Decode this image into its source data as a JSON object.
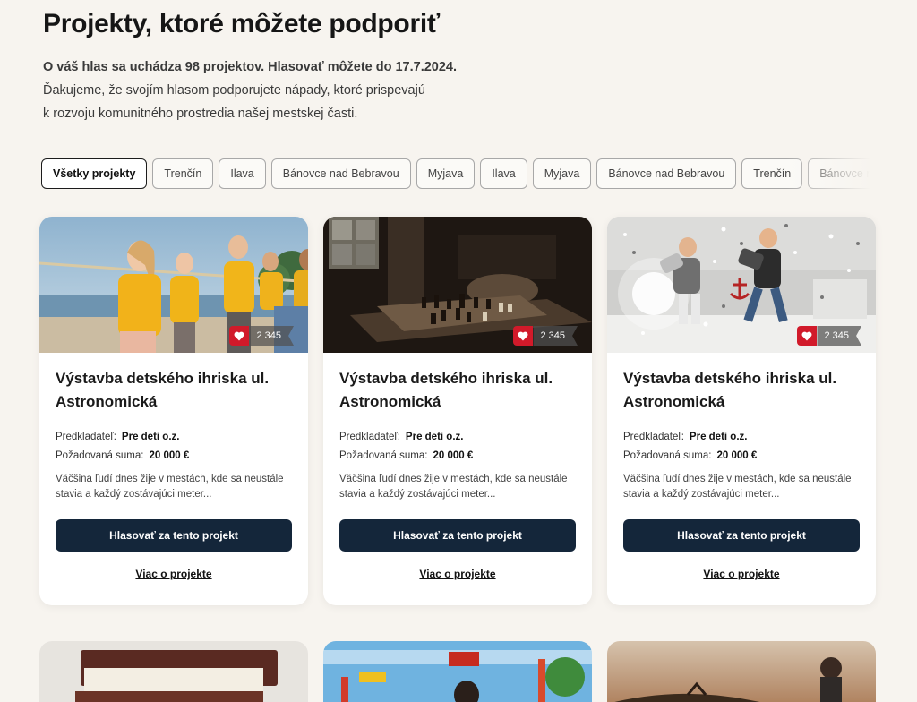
{
  "page": {
    "title": "Projekty, ktoré môžete podporiť",
    "intro_lead": "O váš hlas sa uchádza 98 projektov. Hlasovať môžete do 17.7.2024.",
    "intro_line1": "Ďakujeme, že svojím hlasom podporujete nápady, ktoré prispevajú",
    "intro_line2": "k rozvoju komunitného prostredia našej mestskej časti."
  },
  "filters": [
    {
      "label": "Všetky projekty",
      "active": true
    },
    {
      "label": "Trenčín"
    },
    {
      "label": "Ilava"
    },
    {
      "label": "Bánovce nad Bebravou"
    },
    {
      "label": "Myjava"
    },
    {
      "label": "Ilava"
    },
    {
      "label": "Myjava"
    },
    {
      "label": "Bánovce nad Bebravou"
    },
    {
      "label": "Trenčín"
    },
    {
      "label": "Bánovce nad Bebravou"
    }
  ],
  "cards": [
    {
      "image": "children-tug-of-war-photo",
      "likes": "2 345",
      "title": "Výstavba detského ihriska ul. Astronomická",
      "proposer_label": "Predkladateľ:",
      "proposer": "Pre deti o.z.",
      "amount_label": "Požadovaná suma:",
      "amount": "20 000 €",
      "description": "Väčšina ľudí dnes žije v mestách, kde sa neustále stavia a každý zostávajúci meter...",
      "vote_label": "Hlasovať za tento projekt",
      "more_label": "Viac o projekte"
    },
    {
      "image": "chessboard-dark-room-photo",
      "likes": "2 345",
      "title": "Výstavba detského ihriska ul. Astronomická",
      "proposer_label": "Predkladateľ:",
      "proposer": "Pre deti o.z.",
      "amount_label": "Požadovaná suma:",
      "amount": "20 000 €",
      "description": "Väčšina ľudí dnes žije v mestách, kde sa neustále stavia a každý zostávajúci meter...",
      "vote_label": "Hlasovať za tento projekt",
      "more_label": "Viac o projekte"
    },
    {
      "image": "pillow-fight-bed-photo",
      "likes": "2 345",
      "title": "Výstavba detského ihriska ul. Astronomická",
      "proposer_label": "Predkladateľ:",
      "proposer": "Pre deti o.z.",
      "amount_label": "Požadovaná suma:",
      "amount": "20 000 €",
      "description": "Väčšina ľudí dnes žije v mestách, kde sa neustále stavia a každý zostávajúci meter...",
      "vote_label": "Hlasovať za tento projekt",
      "more_label": "Viac o projekte"
    }
  ],
  "next_row_images": [
    "books-stack-photo",
    "playground-photo",
    "sunset-field-photo"
  ],
  "colors": {
    "background": "#f7f4ef",
    "button": "#14263a",
    "heart": "#d11a2a"
  }
}
